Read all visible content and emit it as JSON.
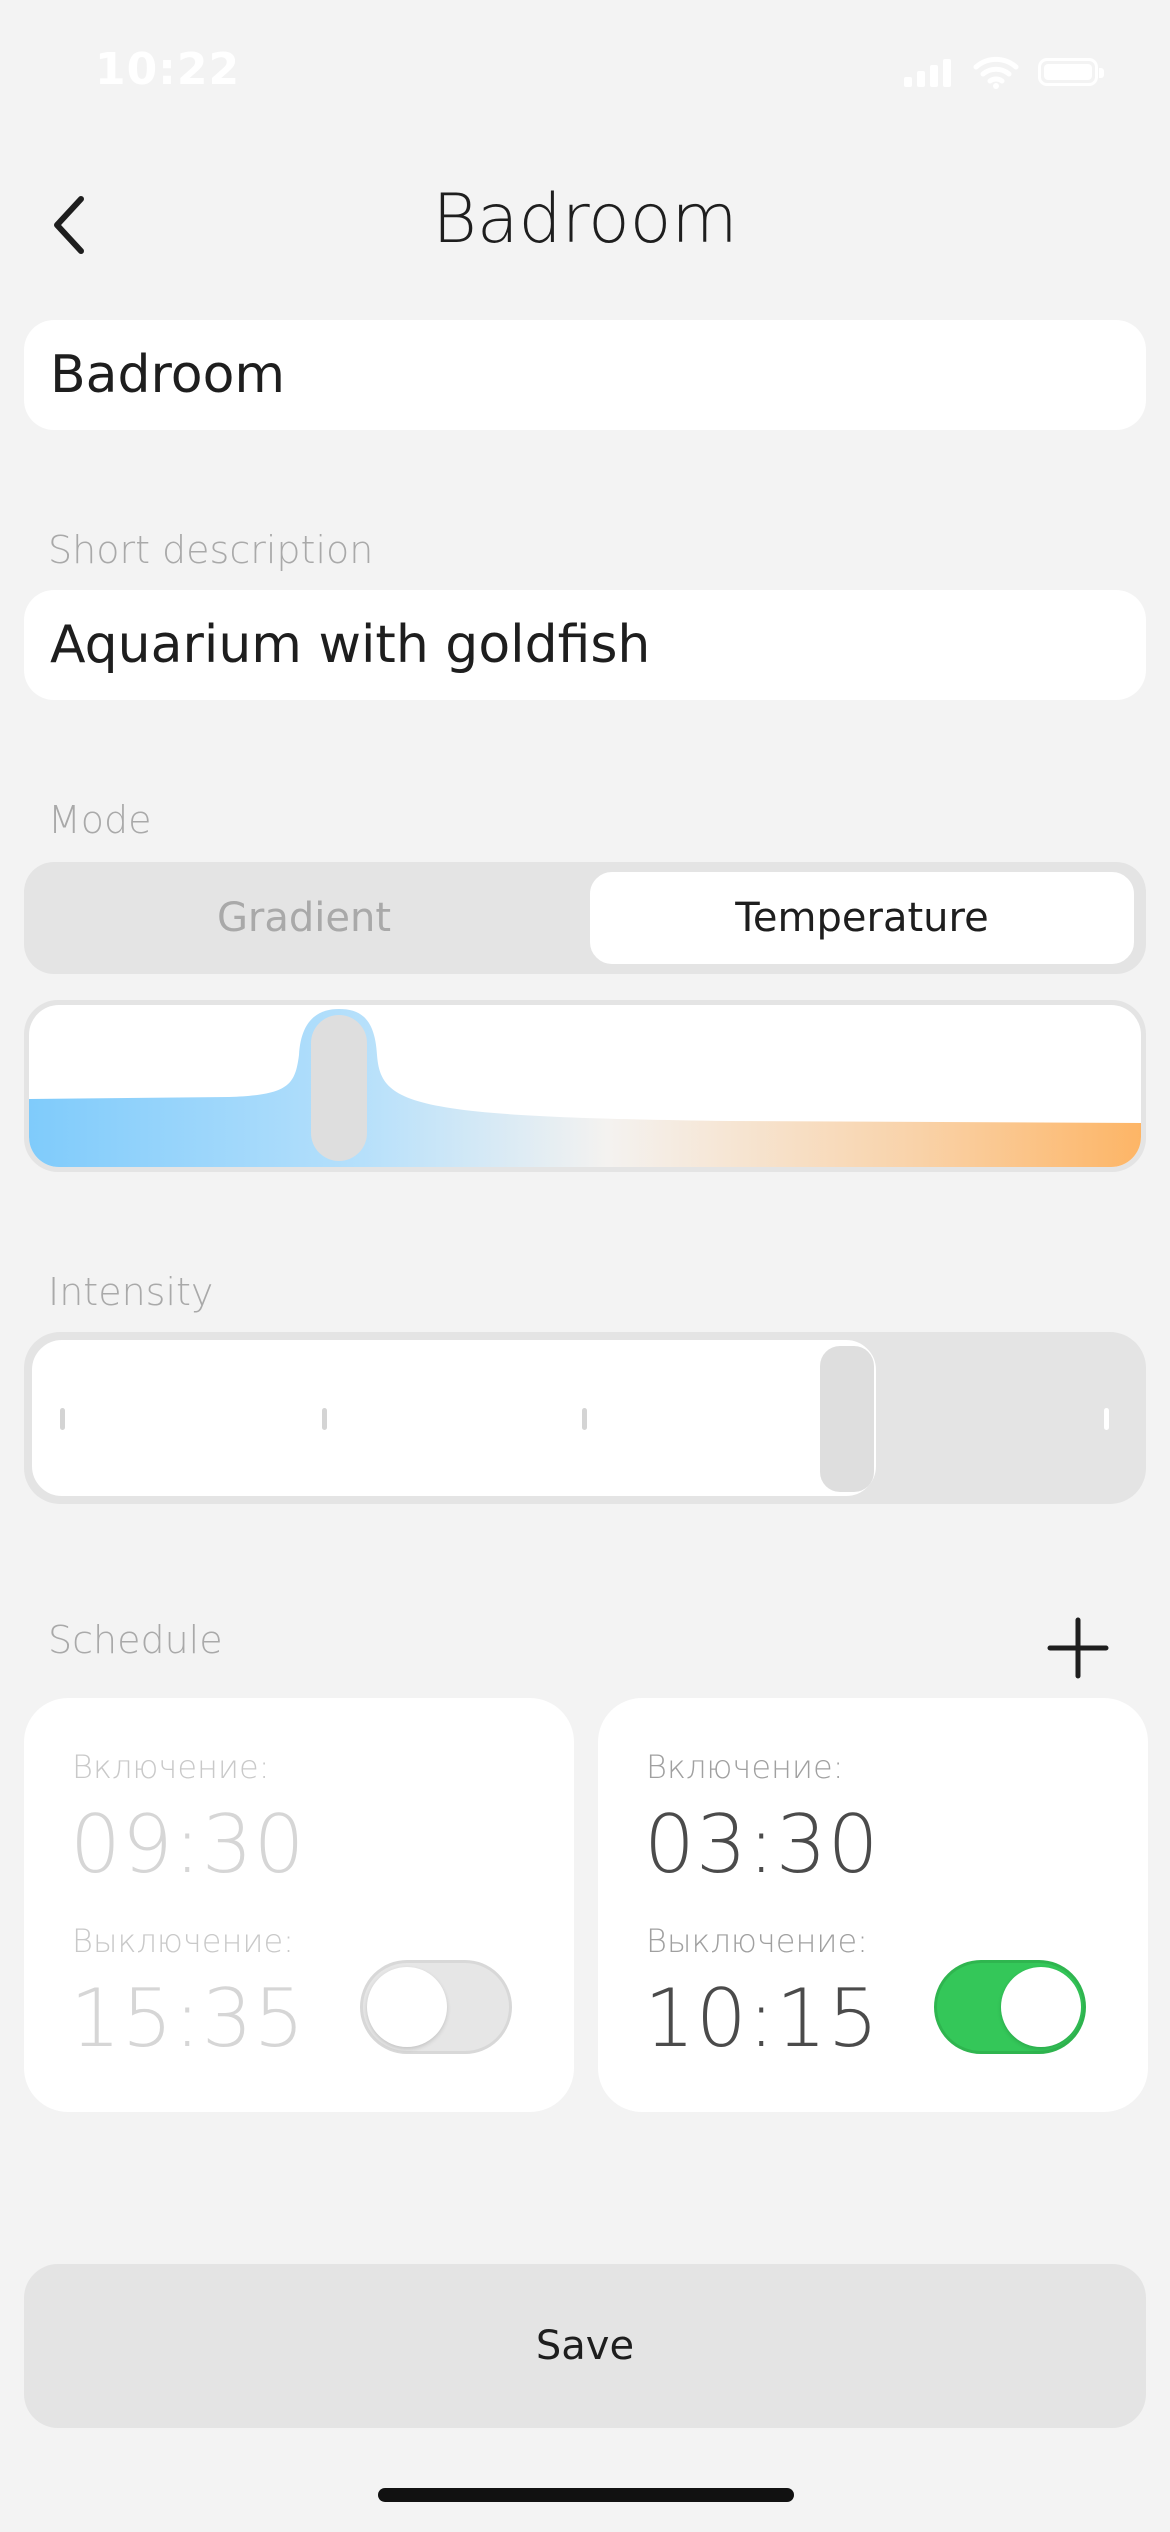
{
  "status_bar": {
    "time": "10:22",
    "icons": [
      "signal-icon",
      "wifi-icon",
      "battery-icon"
    ]
  },
  "header": {
    "title": "Badroom",
    "back_icon": "chevron-left-icon"
  },
  "name_field": {
    "value": "Badroom"
  },
  "description": {
    "label": "Short description",
    "value": "Aquarium with goldfish"
  },
  "mode": {
    "label": "Mode",
    "options": [
      "Gradient",
      "Temperature"
    ],
    "selected": "Temperature"
  },
  "temperature_slider": {
    "value_fraction": 0.28,
    "colors": {
      "cold": "#7fcbfb",
      "neutral": "#f4f2f0",
      "warm": "#fdb566"
    }
  },
  "intensity": {
    "label": "Intensity",
    "value_fraction": 0.75
  },
  "schedule": {
    "label": "Schedule",
    "add_icon": "plus-icon",
    "items": [
      {
        "on_label": "Включение:",
        "on_time": "09:30",
        "off_label": "Выключение:",
        "off_time": "15:35",
        "enabled": false
      },
      {
        "on_label": "Включение:",
        "on_time": "03:30",
        "off_label": "Выключение:",
        "off_time": "10:15",
        "enabled": true
      }
    ]
  },
  "save_button": {
    "label": "Save"
  },
  "colors": {
    "background": "#f3f3f3",
    "toggle_on": "#34c759",
    "muted_text": "#a9a9a9"
  }
}
